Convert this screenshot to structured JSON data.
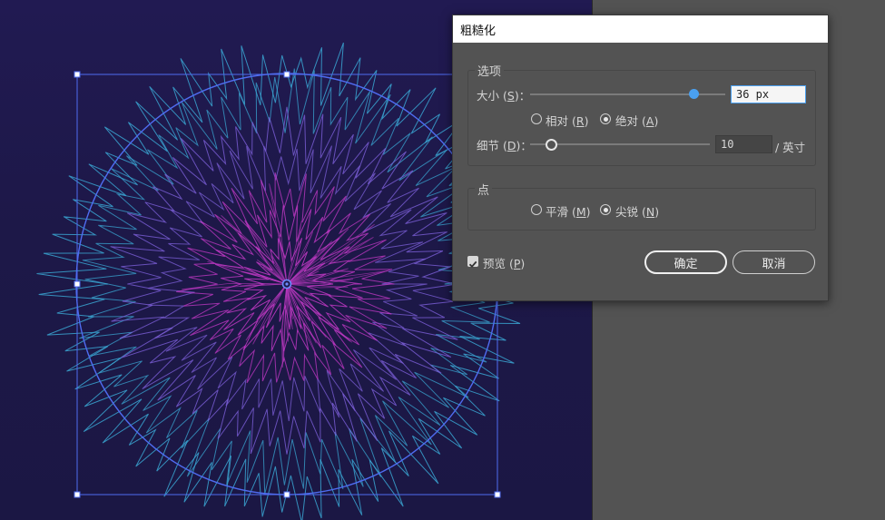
{
  "dialog": {
    "title": "粗糙化",
    "options_group": {
      "title": "选项",
      "size": {
        "label": "大小",
        "key": "S",
        "value": "36 px",
        "slider_level": 0.88
      },
      "mode": [
        {
          "label": "相对",
          "key": "R",
          "selected": false
        },
        {
          "label": "绝对",
          "key": "A",
          "selected": true
        }
      ],
      "detail": {
        "label": "细节",
        "key": "D",
        "value": "10",
        "unit": "/ 英寸",
        "slider_level": 0.1
      }
    },
    "points_group": {
      "title": "点",
      "options": [
        {
          "label": "平滑",
          "key": "M",
          "selected": false
        },
        {
          "label": "尖锐",
          "key": "N",
          "selected": true
        }
      ]
    },
    "preview": {
      "label": "预览",
      "key": "P",
      "checked": true
    },
    "ok_label": "确定",
    "cancel_label": "取消"
  },
  "colors": {
    "canvas_bg": "#1e1a4c",
    "selection": "#4f6cf0",
    "accent": "#4aa0f0",
    "stroke_inner": "#c43ac8",
    "stroke_mid": "#7c5fd8",
    "stroke_outer": "#3aa6d2"
  }
}
